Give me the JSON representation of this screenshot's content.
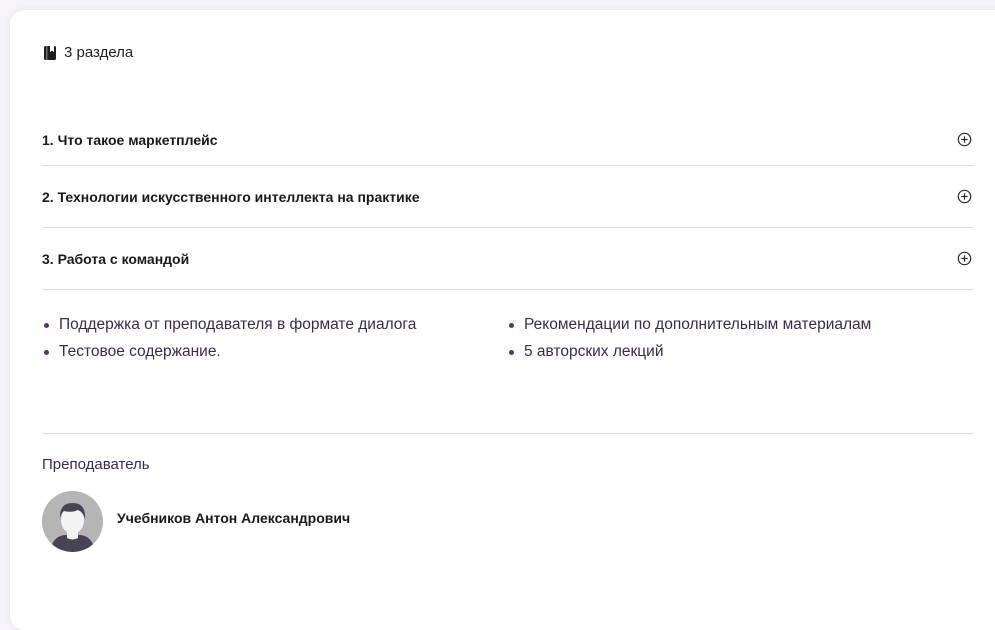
{
  "header": {
    "sections_count": "3 раздела",
    "icon": "book-icon"
  },
  "sections": [
    {
      "title": "1. Что такое маркетплейс",
      "icon": "plus-circle-icon"
    },
    {
      "title": "2. Технологии искусственного интеллекта на практике",
      "icon": "plus-circle-icon"
    },
    {
      "title": "3. Работа с командой",
      "icon": "plus-circle-icon"
    }
  ],
  "features": [
    "Поддержка от преподавателя в формате диалога",
    "Рекомендации по дополнительным материалам",
    "Тестовое содержание.",
    "5 авторских лекций"
  ],
  "teacher": {
    "label": "Преподаватель",
    "name": "Учебников Антон Александрович",
    "avatar": "user-avatar"
  },
  "colors": {
    "accent_text": "#3b2a4f",
    "bullet": "#5a2f7c",
    "divider": "#dcdcdc"
  }
}
